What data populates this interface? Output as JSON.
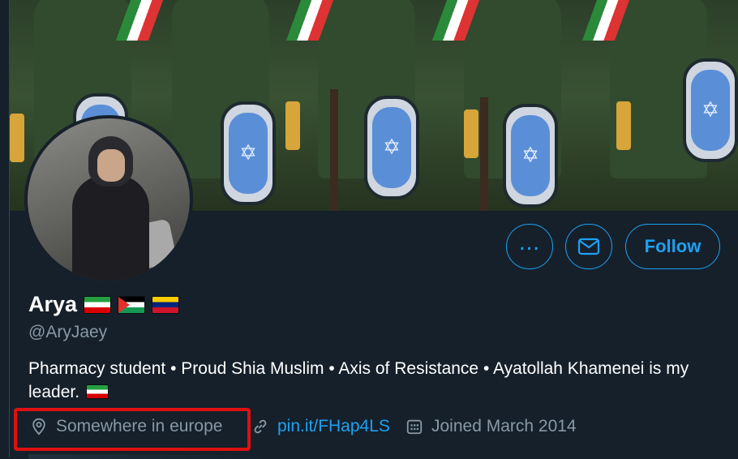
{
  "profile": {
    "display_name": "Arya",
    "handle": "@AryJaey",
    "name_flags": [
      "iran-flag",
      "palestine-flag",
      "venezuela-flag"
    ],
    "bio_text": "Pharmacy student • Proud Shia Muslim • Axis of Resistance • Ayatollah Khamenei is my leader.",
    "bio_flag": "iran-flag",
    "location": "Somewhere in europe",
    "link": "pin.it/FHap4LS",
    "joined": "Joined March 2014"
  },
  "actions": {
    "more_icon": "more-dots-icon",
    "message_icon": "envelope-icon",
    "follow_label": "Follow"
  },
  "icons": {
    "location": "location-pin-icon",
    "link": "link-icon",
    "joined": "calendar-icon"
  },
  "colors": {
    "background": "#15202b",
    "accent": "#1da1f2",
    "muted_text": "#8899a6",
    "highlight_box": "#e01010"
  }
}
